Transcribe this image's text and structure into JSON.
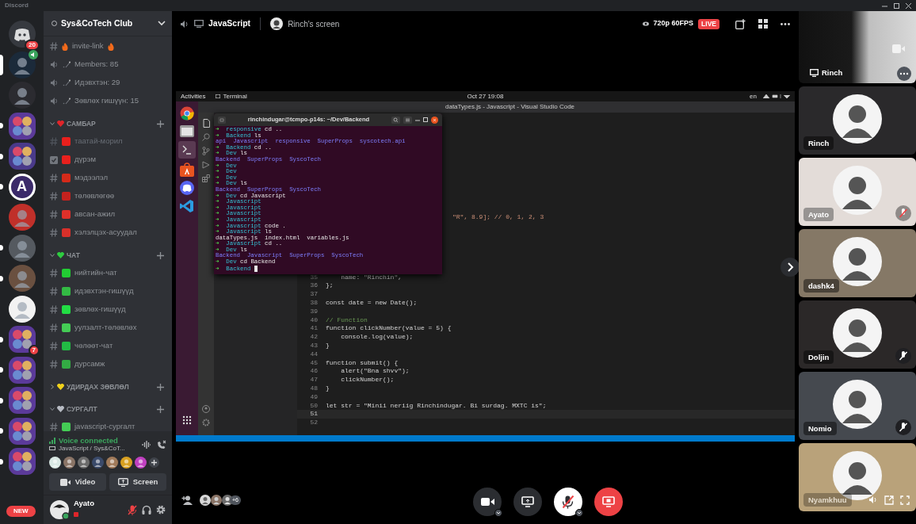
{
  "window": {
    "title": "Discord"
  },
  "servers": [
    {
      "kind": "home",
      "color": "#36393f",
      "badge": "20",
      "selected": false,
      "unread": false,
      "voice": false
    },
    {
      "kind": "avatar",
      "color": "#1b2a3a",
      "selected": true,
      "unread": false,
      "voice": true
    },
    {
      "kind": "avatar",
      "color": "#2b2b30",
      "selected": false,
      "unread": false,
      "voice": false
    },
    {
      "kind": "folder",
      "color": "#5b3a9a",
      "selected": false,
      "unread": true,
      "voice": false
    },
    {
      "kind": "folder",
      "color": "#4a3a8a",
      "selected": false,
      "unread": true,
      "voice": false
    },
    {
      "kind": "letter",
      "label": "A",
      "color": "#3b2a6a",
      "selected": false,
      "unread": true,
      "voice": false
    },
    {
      "kind": "avatar",
      "color": "#c0302a",
      "selected": false,
      "unread": false,
      "voice": false
    },
    {
      "kind": "avatar",
      "color": "#555a60",
      "selected": false,
      "unread": true,
      "voice": false
    },
    {
      "kind": "avatar",
      "color": "#6a5040",
      "selected": false,
      "unread": true,
      "voice": false
    },
    {
      "kind": "avatar",
      "color": "#f2f2f2",
      "selected": false,
      "unread": false,
      "voice": false
    },
    {
      "kind": "folder",
      "color": "#5b3a9a",
      "badge": "7",
      "selected": false,
      "unread": true,
      "voice": false
    },
    {
      "kind": "folder",
      "color": "#5b3a9a",
      "selected": false,
      "unread": true,
      "voice": false
    },
    {
      "kind": "folder",
      "color": "#5b3a9a",
      "selected": false,
      "unread": true,
      "voice": false
    },
    {
      "kind": "folder",
      "color": "#5b3a9a",
      "selected": false,
      "unread": true,
      "voice": false
    },
    {
      "kind": "folder",
      "color": "#5b3a9a",
      "selected": false,
      "unread": true,
      "voice": false
    }
  ],
  "new_button": "NEW",
  "server_name": "Sys&CoTech Club",
  "channels": [
    {
      "kind": "text",
      "name": "invite-link",
      "color": "#f26a1b",
      "muted": false
    },
    {
      "kind": "voice",
      "name": "Members: 85",
      "muted": false
    },
    {
      "kind": "voice",
      "name": "Идэвхтэн: 29",
      "muted": false
    },
    {
      "kind": "voice",
      "name": "Зөвлөх гишүүн: 15",
      "muted": false
    }
  ],
  "categories": [
    {
      "title": "САМБАР",
      "color": "#e0252a",
      "expanded": true,
      "channels": [
        {
          "kind": "text",
          "name": "таатай-морил",
          "color": "#e8201d",
          "muted": true
        },
        {
          "kind": "rules",
          "name": "дүрэм",
          "color": "#e8201d",
          "muted": false
        },
        {
          "kind": "text",
          "name": "мэдээлэл",
          "color": "#d42a1a",
          "muted": false
        },
        {
          "kind": "text",
          "name": "төлөвлөгөө",
          "color": "#c4221e",
          "muted": false
        },
        {
          "kind": "text",
          "name": "авсан-ажил",
          "color": "#e0302a",
          "muted": false
        },
        {
          "kind": "text",
          "name": "хэлэлцэх-асуудал",
          "color": "#d8302a",
          "muted": false
        }
      ]
    },
    {
      "title": "ЧАТ",
      "color": "#2ecc40",
      "expanded": true,
      "channels": [
        {
          "kind": "text",
          "name": "нийтийн-чат",
          "color": "#22cc33",
          "muted": false
        },
        {
          "kind": "text",
          "name": "идэвхтэн-гишүүд",
          "color": "#33bb44",
          "muted": false
        },
        {
          "kind": "text",
          "name": "зөвлөх-гишүүд",
          "color": "#22dd44",
          "muted": false
        },
        {
          "kind": "text",
          "name": "уулзалт-төлөвлөх",
          "color": "#44cc55",
          "muted": false
        },
        {
          "kind": "text",
          "name": "чөлөөт-чат",
          "color": "#22bb44",
          "muted": false
        },
        {
          "kind": "text",
          "name": "дурсамж",
          "color": "#33aa44",
          "muted": false
        }
      ]
    },
    {
      "title": "УДИРДАХ ЗӨВЛӨЛ",
      "color": "#f2d21b",
      "expanded": false
    },
    {
      "title": "СУРГАЛТ",
      "color": "#b8bcc4",
      "expanded": true,
      "channels": [
        {
          "kind": "text",
          "name": "javascript-сургалт",
          "color": "#44cc55",
          "muted": false
        }
      ]
    }
  ],
  "voice": {
    "status": "Voice connected",
    "channel": "JavaScript / Sys&CoT...",
    "participants": [
      {
        "color": "#d9e8e4"
      },
      {
        "color": "#8a7466"
      },
      {
        "color": "#6b6b6b"
      },
      {
        "color": "#3a4a6a"
      },
      {
        "color": "#a07a5a"
      },
      {
        "color": "#d8a020"
      },
      {
        "color": "#c040c0"
      }
    ],
    "buttons": [
      "Video",
      "Screen"
    ]
  },
  "user": {
    "name": "Ayato",
    "muted": true
  },
  "header": {
    "channel": "JavaScript",
    "stream": "Rinch's screen",
    "quality": "720p 60FPS",
    "live": "LIVE"
  },
  "screen": {
    "activities": "Activities",
    "app": "Terminal",
    "clock": "Oct 27 19:08",
    "lang": "en",
    "vscode_title": "dataTypes.js - Javascript - Visual Studio Code",
    "terminal": {
      "title": "rinchindugar@tcmpo-p14s: ~/Dev/Backend",
      "lines": [
        {
          "kind": "prompt",
          "mark": "➜",
          "dir": "responsive",
          "cmd": "cd .."
        },
        {
          "kind": "prompt",
          "mark": "➜",
          "dir": "Backend",
          "cmd": "ls"
        },
        {
          "kind": "dirs",
          "text": "api  Javascript  responsive  SuperProps  syscotech.api"
        },
        {
          "kind": "prompt",
          "mark": "➜",
          "dir": "Backend",
          "cmd": "cd .."
        },
        {
          "kind": "prompt",
          "mark": "➜",
          "dir": "Dev",
          "cmd": "ls"
        },
        {
          "kind": "dirs",
          "text": "Backend  SuperProps  SyscoTech"
        },
        {
          "kind": "prompt",
          "mark": "➜",
          "dir": "Dev"
        },
        {
          "kind": "prompt",
          "mark": "➜",
          "dir": "Dev"
        },
        {
          "kind": "prompt",
          "mark": "➜",
          "dir": "Dev"
        },
        {
          "kind": "prompt",
          "mark": "➜",
          "dir": "Dev",
          "cmd": "ls"
        },
        {
          "kind": "dirs",
          "text": "Backend  SuperProps  SyscoTech"
        },
        {
          "kind": "prompt",
          "mark": "➜",
          "dir": "Dev",
          "cmd": "cd Javascript"
        },
        {
          "kind": "prompt",
          "mark": "➜",
          "dir": "Javascript"
        },
        {
          "kind": "prompt",
          "mark": "➜",
          "dir": "Javascript"
        },
        {
          "kind": "prompt",
          "mark": "➜",
          "dir": "Javascript"
        },
        {
          "kind": "prompt",
          "mark": "➜",
          "dir": "Javascript"
        },
        {
          "kind": "prompt",
          "mark": "➜",
          "dir": "Javascript",
          "cmd": "code ."
        },
        {
          "kind": "prompt",
          "mark": "➜",
          "dir": "Javascript",
          "cmd": "ls"
        },
        {
          "kind": "files",
          "text": "dataTypes.js  index.html  variables.js"
        },
        {
          "kind": "prompt",
          "mark": "➜",
          "dir": "Javascript",
          "cmd": "cd .."
        },
        {
          "kind": "prompt",
          "mark": "➜",
          "dir": "Dev",
          "cmd": "ls"
        },
        {
          "kind": "dirs",
          "text": "Backend  Javascript  SuperProps  SyscoTech"
        },
        {
          "kind": "prompt",
          "mark": "➜",
          "dir": "Dev",
          "cmd": "cd Backend"
        },
        {
          "kind": "prompt",
          "mark": "➜",
          "dir": "Backend",
          "cursor": true
        }
      ]
    },
    "code_fragment": "\"R\", 8.9]; // 0, 1, 2, 3",
    "code": [
      {
        "n": "35",
        "kind": "code",
        "text": "    name: \"Rinchin\","
      },
      {
        "n": "36",
        "kind": "code",
        "text": "};"
      },
      {
        "n": "37"
      },
      {
        "n": "38",
        "kind": "code",
        "text": "const date = new Date();"
      },
      {
        "n": "39"
      },
      {
        "n": "40",
        "kind": "comment",
        "text": "// Function"
      },
      {
        "n": "41",
        "kind": "code",
        "text": "function clickNumber(value = 5) {"
      },
      {
        "n": "42",
        "kind": "code",
        "text": "    console.log(value);"
      },
      {
        "n": "43",
        "kind": "code",
        "text": "}"
      },
      {
        "n": "44"
      },
      {
        "n": "45",
        "kind": "code",
        "text": "function submit() {"
      },
      {
        "n": "46",
        "kind": "code",
        "text": "    alert(\"Bna shvv\");"
      },
      {
        "n": "47",
        "kind": "code",
        "text": "    clickNumber();"
      },
      {
        "n": "48",
        "kind": "code",
        "text": "}"
      },
      {
        "n": "49"
      },
      {
        "n": "50",
        "kind": "code",
        "text": "let str = \"Minii neriig Rinchindugar. Bi surdag. MXTC is\";"
      },
      {
        "n": "51",
        "current": true
      },
      {
        "n": "52"
      }
    ]
  },
  "others": "+6",
  "preview": {
    "label": "Rinch"
  },
  "tiles": [
    {
      "name": "Rinch",
      "color": "#2a292b",
      "muted": false,
      "server_muted": false,
      "hover": false
    },
    {
      "name": "Ayato",
      "color": "#e3dcd8",
      "muted": true,
      "server_muted": true,
      "hover": false
    },
    {
      "name": "dashk4",
      "color": "#857866",
      "muted": false,
      "server_muted": false,
      "hover": false
    },
    {
      "name": "Doljin",
      "color": "#2b2828",
      "muted": true,
      "server_muted": false,
      "hover": false
    },
    {
      "name": "Nomio",
      "color": "#45494f",
      "muted": true,
      "server_muted": false,
      "hover": false
    },
    {
      "name": "Nyamkhuu",
      "color": "#b9a27a",
      "muted": false,
      "server_muted": false,
      "hover": true
    }
  ]
}
